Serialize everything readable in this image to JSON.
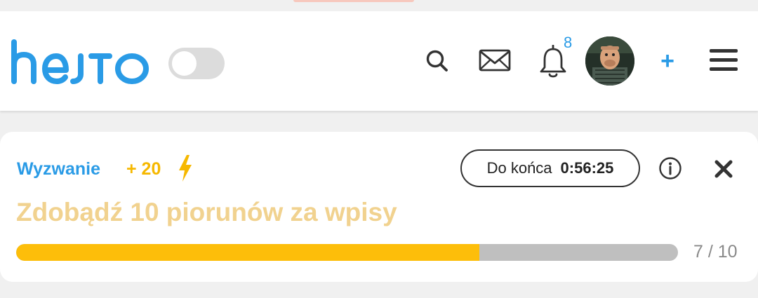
{
  "header": {
    "logo_text": "hejto",
    "dark_mode_toggle": {
      "on": false
    },
    "icons": {
      "search": "search-icon",
      "messages": "mail-icon",
      "notifications": "bell-icon",
      "add": "plus-icon",
      "menu": "hamburger-icon"
    },
    "notification_count": "8",
    "add_label": "+"
  },
  "challenge": {
    "label": "Wyzwanie",
    "points": "+ 20",
    "points_icon": "lightning-icon",
    "timer_label": "Do końca",
    "timer_value": "0:56:25",
    "info_icon": "info-icon",
    "close_icon": "close-icon",
    "title": "Zdobądź 10 piorunów za wpisy",
    "progress_current": 7,
    "progress_total": 10,
    "progress_text": "7 / 10"
  },
  "colors": {
    "brand_blue": "#2a9be6",
    "accent_yellow": "#fdbe0a",
    "title_yellow": "#f1d28f",
    "track_gray": "#bfbfbf"
  }
}
